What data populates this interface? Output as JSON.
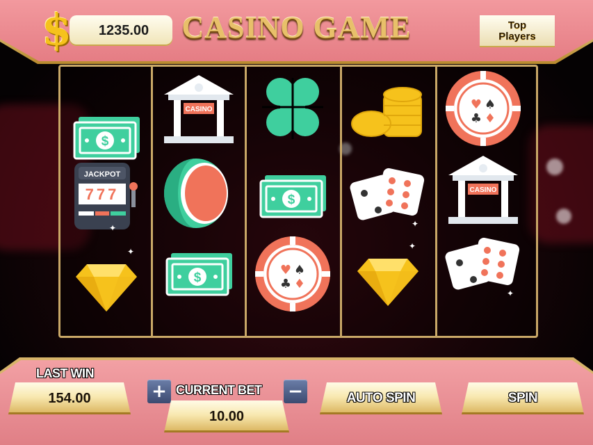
{
  "header": {
    "title": "CASINO GAME",
    "balance": "1235.00",
    "top_players_label": "Top Players"
  },
  "reels": [
    [
      "cash-icon",
      "slot-machine-icon",
      "diamond-icon"
    ],
    [
      "casino-building-icon",
      "watermelon-icon",
      "cash-icon"
    ],
    [
      "clover-icon",
      "cash-icon",
      "poker-chip-icon"
    ],
    [
      "coins-icon",
      "dice-icon",
      "diamond-icon"
    ],
    [
      "poker-chip-icon",
      "casino-building-icon",
      "dice-icon"
    ]
  ],
  "symbol_text": {
    "casino_sign": "CASINO",
    "jackpot": "JACKPOT",
    "sevens": "777"
  },
  "controls": {
    "last_win_label": "LAST WIN",
    "last_win_value": "154.00",
    "current_bet_label": "CURRENT BET",
    "current_bet_value": "10.00",
    "plus": "+",
    "minus": "−",
    "auto_spin_label": "AUTO SPIN",
    "spin_label": "SPIN"
  },
  "colors": {
    "pink": "#e8878d",
    "gold": "#c9a867",
    "mint": "#3fcf9e",
    "coral": "#f0735a",
    "yellow": "#f6c21c"
  }
}
